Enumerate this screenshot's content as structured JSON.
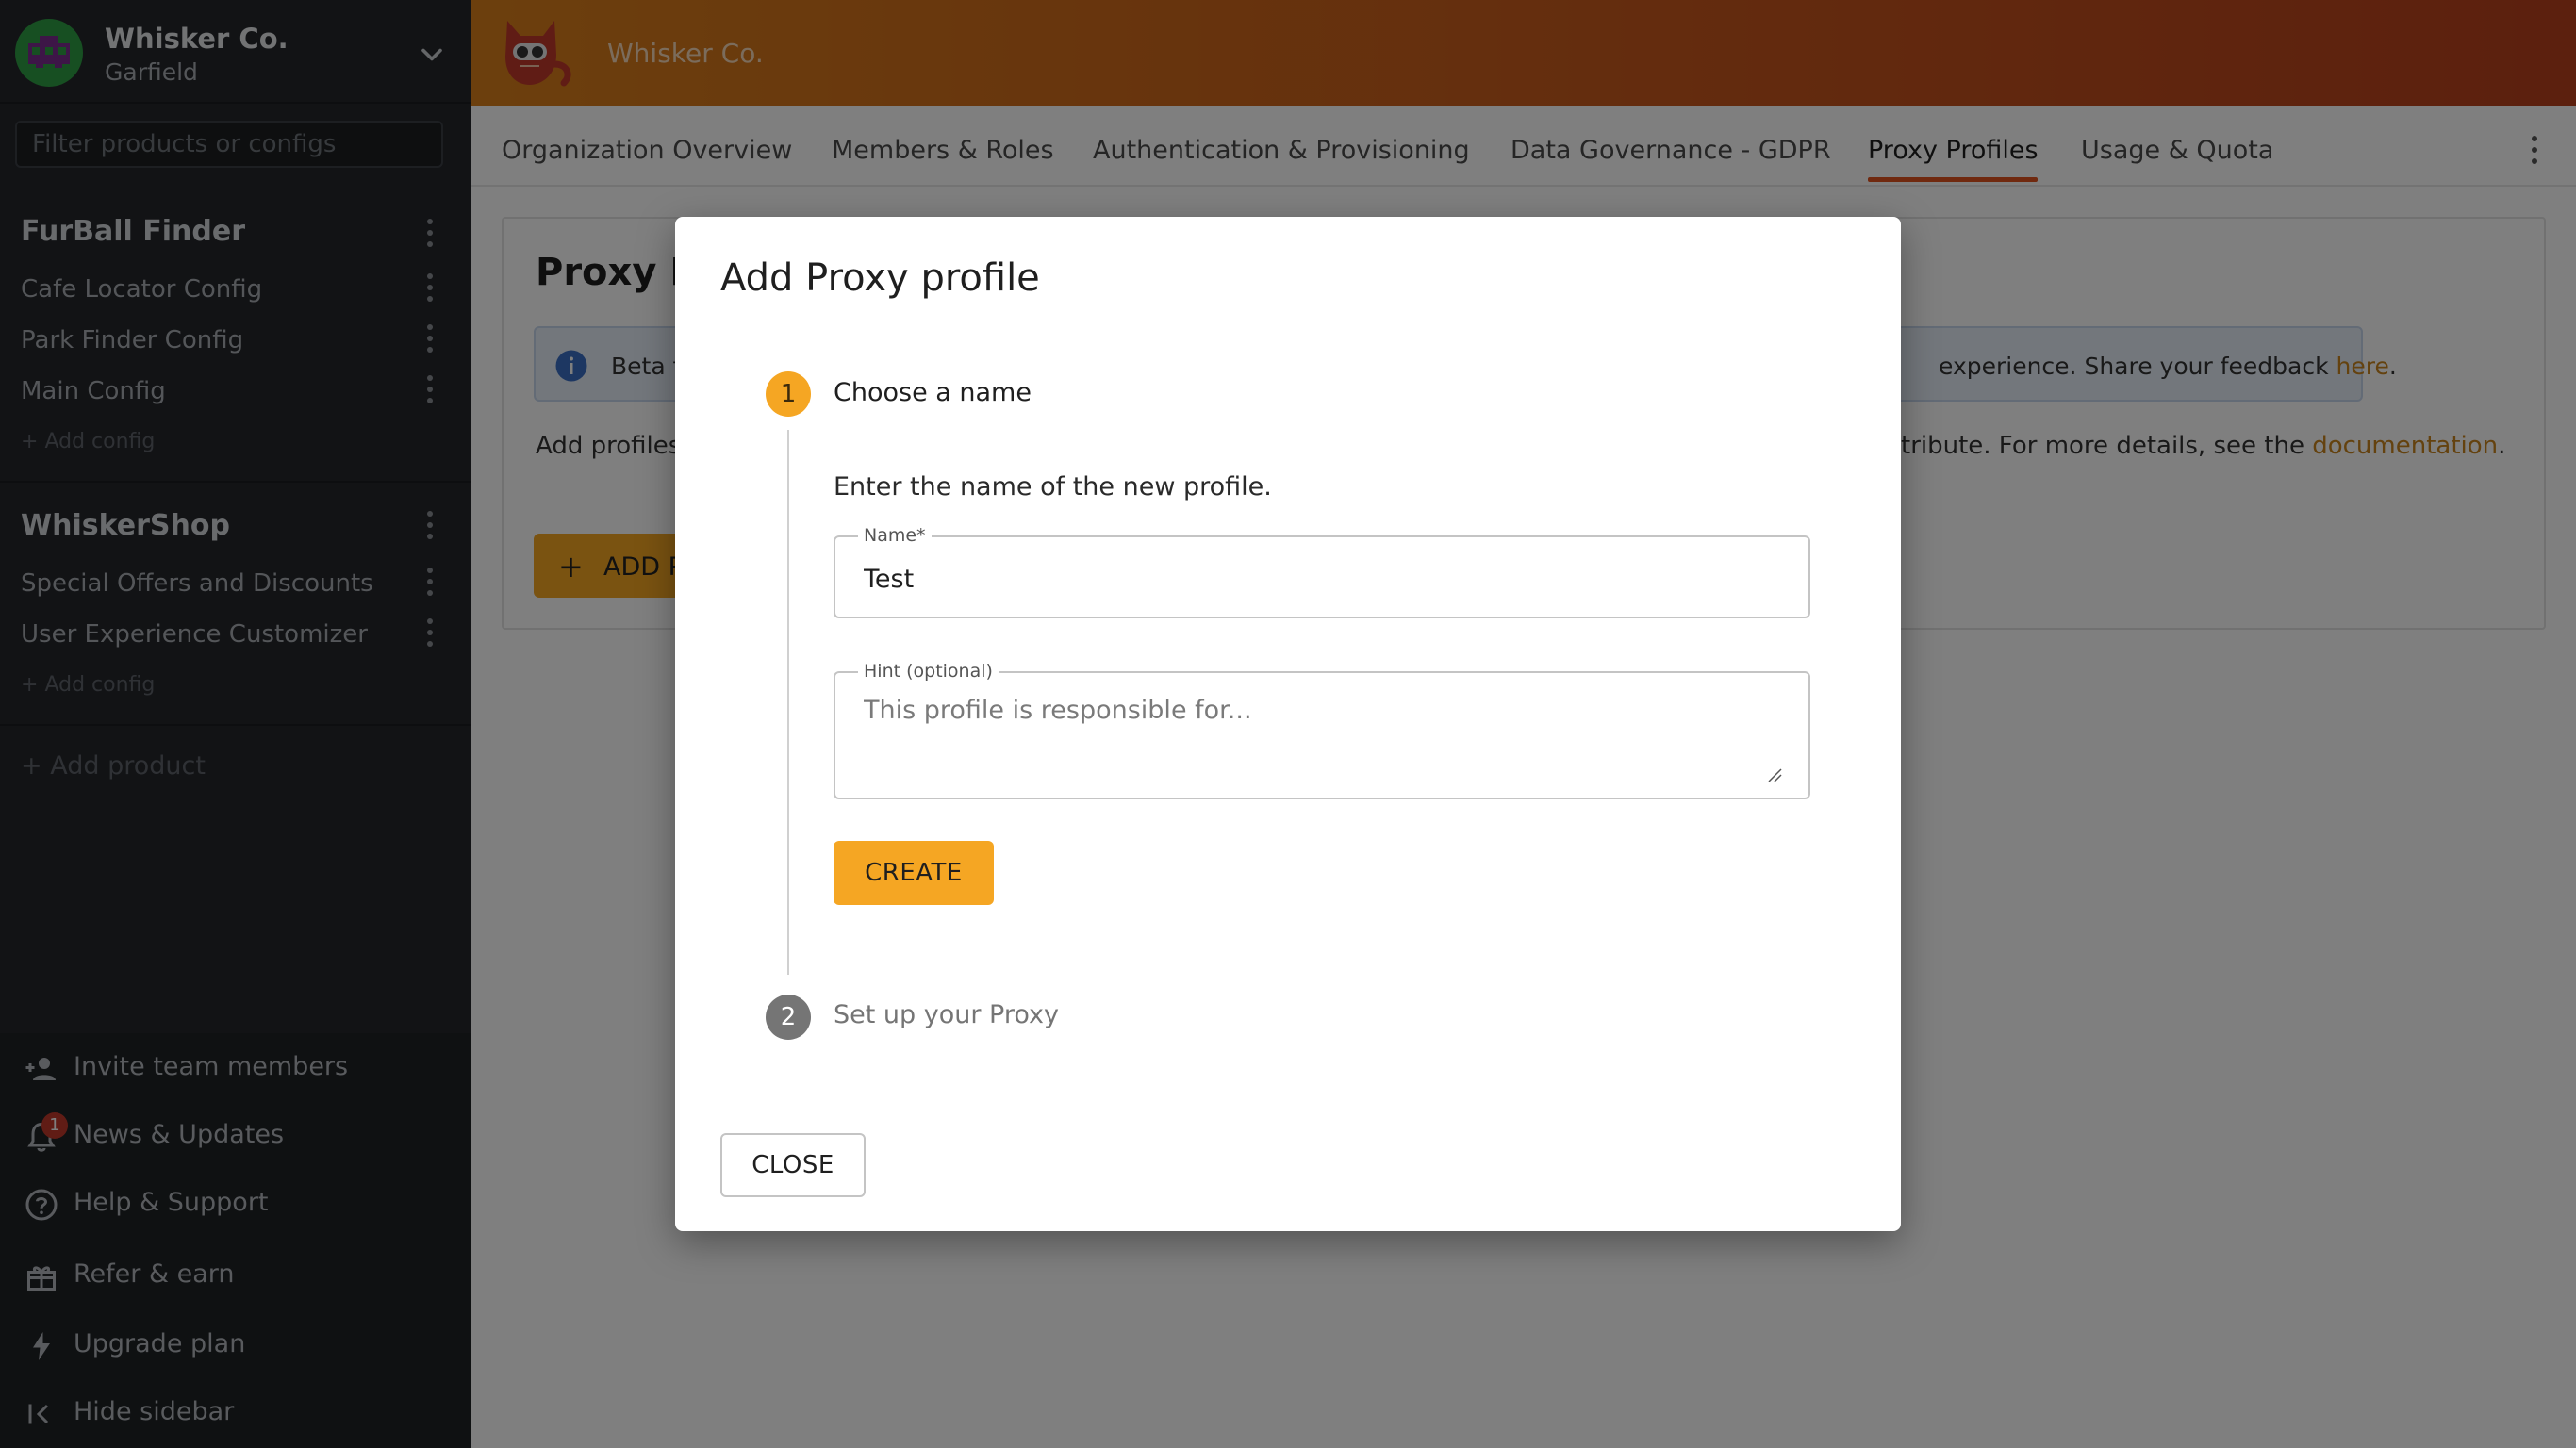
{
  "sidebar": {
    "org_name": "Whisker Co.",
    "org_user": "Garfield",
    "filter_placeholder": "Filter products or configs",
    "products": [
      {
        "name": "FurBall Finder",
        "configs": [
          "Cafe Locator Config",
          "Park Finder Config",
          "Main Config"
        ],
        "add_config": "Add config"
      },
      {
        "name": "WhiskerShop",
        "configs": [
          "Special Offers and Discounts",
          "User Experience Customizer"
        ],
        "add_config": "Add config"
      }
    ],
    "add_product": "Add product",
    "bottom_items": [
      {
        "label": "Invite team members",
        "icon": "person-add-icon"
      },
      {
        "label": "News & Updates",
        "icon": "bell-icon",
        "badge": "1"
      },
      {
        "label": "Help & Support",
        "icon": "help-circle-icon"
      },
      {
        "label": "Refer & earn",
        "icon": "gift-icon"
      },
      {
        "label": "Upgrade plan",
        "icon": "lightning-icon"
      },
      {
        "label": "Hide sidebar",
        "icon": "collapse-left-icon"
      }
    ]
  },
  "header": {
    "title": "Whisker Co."
  },
  "tabs": [
    {
      "label": "Organization Overview"
    },
    {
      "label": "Members & Roles"
    },
    {
      "label": "Authentication & Provisioning"
    },
    {
      "label": "Data Governance - GDPR"
    },
    {
      "label": "Proxy Profiles",
      "active": true
    },
    {
      "label": "Usage & Quota"
    }
  ],
  "main": {
    "title": "Proxy P",
    "beta_left": "Beta f",
    "beta_right": "experience. Share your feedback ",
    "beta_link": "here",
    "beta_period": ".",
    "desc_left": "Add profiles",
    "desc_right": "tribute. For more details, see the ",
    "desc_link": "documentation",
    "desc_period": ".",
    "add_button": "ADD P"
  },
  "dialog": {
    "title": "Add Proxy profile",
    "step1": {
      "number": "1",
      "label": "Choose a name"
    },
    "step1_hint": "Enter the name of the new profile.",
    "name_field": {
      "label": "Name*",
      "value": "Test"
    },
    "hint_field": {
      "label": "Hint (optional)",
      "placeholder": "This profile is responsible for..."
    },
    "create_button": "CREATE",
    "step2": {
      "number": "2",
      "label": "Set up your Proxy"
    },
    "close_button": "CLOSE"
  },
  "colors": {
    "accent": "#f5a623",
    "tab_indicator": "#e0531f",
    "link": "#c9841f",
    "sidebar_bg": "#24272b",
    "header_gradient_start": "#d97f1a",
    "header_gradient_end": "#b8401d"
  }
}
